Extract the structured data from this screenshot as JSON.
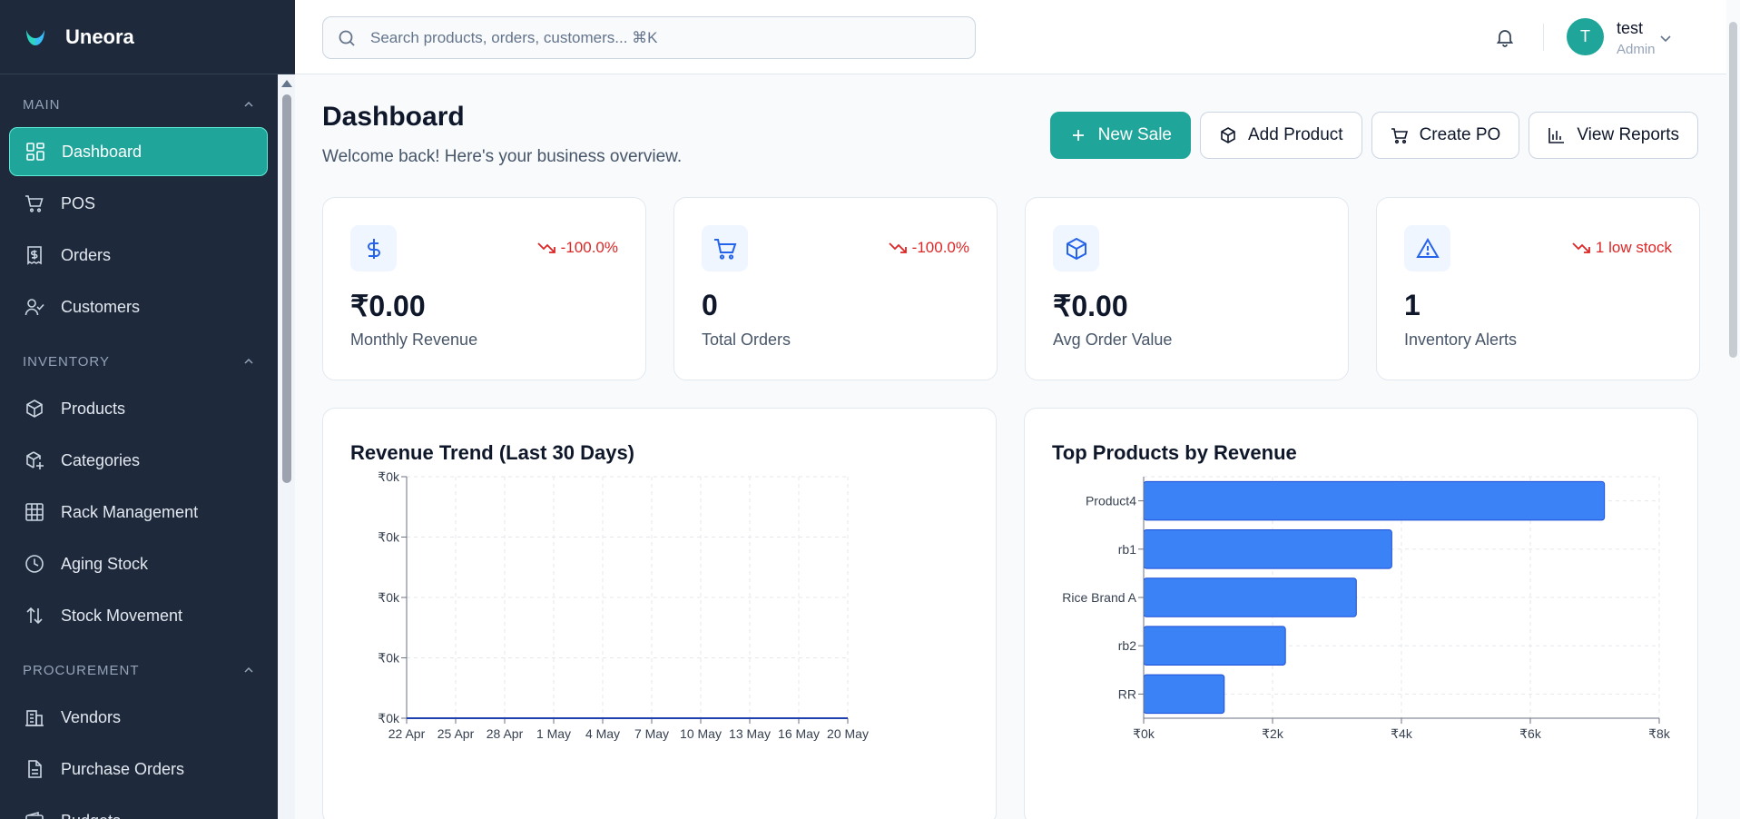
{
  "brand": {
    "name": "Uneora"
  },
  "search": {
    "placeholder": "Search products, orders, customers... ⌘K"
  },
  "user": {
    "initial": "T",
    "name": "test",
    "role": "Admin"
  },
  "sidebar": {
    "sections": [
      {
        "title": "MAIN",
        "items": [
          {
            "label": "Dashboard",
            "icon": "dashboard-icon",
            "active": true
          },
          {
            "label": "POS",
            "icon": "cart-icon"
          },
          {
            "label": "Orders",
            "icon": "receipt-icon"
          },
          {
            "label": "Customers",
            "icon": "user-check-icon"
          }
        ]
      },
      {
        "title": "INVENTORY",
        "items": [
          {
            "label": "Products",
            "icon": "box-icon"
          },
          {
            "label": "Categories",
            "icon": "box-plus-icon"
          },
          {
            "label": "Rack Management",
            "icon": "grid-icon"
          },
          {
            "label": "Aging Stock",
            "icon": "clock-icon"
          },
          {
            "label": "Stock Movement",
            "icon": "arrows-updown-icon"
          }
        ]
      },
      {
        "title": "PROCUREMENT",
        "items": [
          {
            "label": "Vendors",
            "icon": "building-icon"
          },
          {
            "label": "Purchase Orders",
            "icon": "document-icon"
          },
          {
            "label": "Budgets",
            "icon": "wallet-icon"
          }
        ]
      }
    ]
  },
  "page": {
    "title": "Dashboard",
    "subtitle": "Welcome back! Here's your business overview."
  },
  "actions": {
    "new_sale": "New Sale",
    "add_product": "Add Product",
    "create_po": "Create PO",
    "view_reports": "View Reports"
  },
  "stats": [
    {
      "value": "₹0.00",
      "label": "Monthly Revenue",
      "trend": "-100.0%",
      "icon": "dollar-icon"
    },
    {
      "value": "0",
      "label": "Total Orders",
      "trend": "-100.0%",
      "icon": "cart-icon"
    },
    {
      "value": "₹0.00",
      "label": "Avg Order Value",
      "trend": "",
      "icon": "box-icon"
    },
    {
      "value": "1",
      "label": "Inventory Alerts",
      "trend": "1 low stock",
      "icon": "warning-icon"
    }
  ],
  "colors": {
    "accent": "#1fa59a",
    "sidebar": "#1e293b",
    "bar": "#3b82f6",
    "down": "#dc2626"
  },
  "revenue_chart": {
    "title": "Revenue Trend (Last 30 Days)"
  },
  "products_chart": {
    "title": "Top Products by Revenue"
  },
  "chart_data": [
    {
      "type": "line",
      "title": "Revenue Trend (Last 30 Days)",
      "x_tick_labels": [
        "22 Apr",
        "25 Apr",
        "28 Apr",
        "1 May",
        "4 May",
        "7 May",
        "10 May",
        "13 May",
        "16 May",
        "20 May"
      ],
      "y_tick_labels": [
        "₹0k",
        "₹0k",
        "₹0k",
        "₹0k",
        "₹0k"
      ],
      "series": [
        {
          "values": [
            0,
            0,
            0,
            0,
            0,
            0,
            0,
            0,
            0,
            0
          ]
        }
      ],
      "grid": true
    },
    {
      "type": "bar",
      "orientation": "horizontal",
      "title": "Top Products by Revenue",
      "categories": [
        "Product4",
        "rb1",
        "Rice Brand A",
        "rb2",
        "RR"
      ],
      "values": [
        7150,
        3850,
        3300,
        2200,
        1250
      ],
      "x_tick_labels": [
        "₹0k",
        "₹2k",
        "₹4k",
        "₹6k",
        "₹8k"
      ],
      "xlim": [
        0,
        8000
      ],
      "grid": true
    }
  ]
}
